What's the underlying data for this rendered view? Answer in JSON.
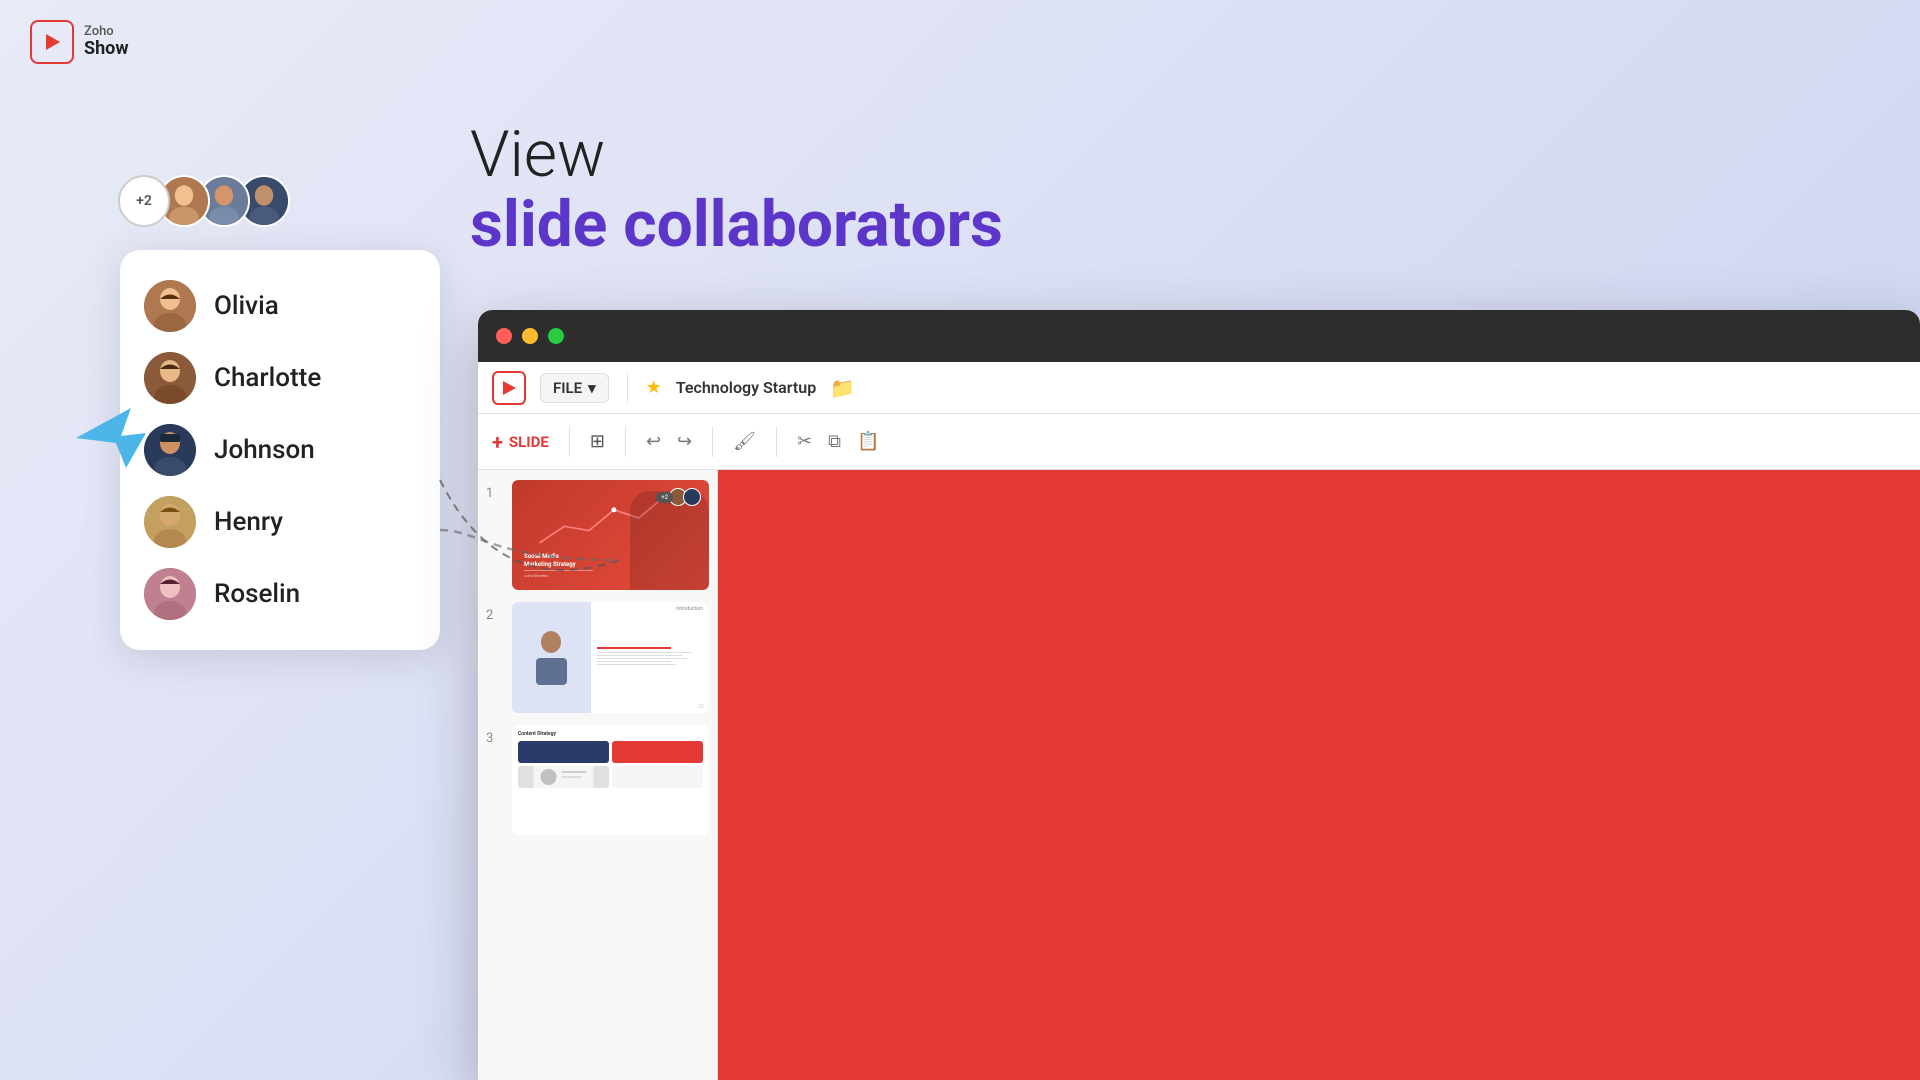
{
  "app": {
    "name": "Zoho Show",
    "logo_text_top": "Zoho",
    "logo_text_bottom": "Show"
  },
  "heading": {
    "line1": "View",
    "line2": "slide collaborators"
  },
  "floating_avatars": {
    "plus_count": "+2"
  },
  "collaborators": [
    {
      "name": "Olivia",
      "color": "#b07850"
    },
    {
      "name": "Charlotte",
      "color": "#8a5a3a"
    },
    {
      "name": "Johnson",
      "color": "#2a3a5a"
    },
    {
      "name": "Henry",
      "color": "#c4a060"
    },
    {
      "name": "Roselin",
      "color": "#b06080"
    }
  ],
  "browser": {
    "toolbar": {
      "file_label": "FILE",
      "file_dropdown_arrow": "▾",
      "star": "★",
      "title": "Technology Startup",
      "folder_icon": "📁"
    },
    "slidebar": {
      "slide_label": "SLIDE",
      "plus": "+"
    },
    "slides": [
      {
        "number": "1",
        "type": "social-media"
      },
      {
        "number": "2",
        "type": "intro"
      },
      {
        "number": "3",
        "type": "content"
      }
    ],
    "collab_badge": "+2"
  },
  "slide1": {
    "title": "Social Media",
    "subtitle": "Marketing Strategy",
    "name": "John Simeths"
  },
  "slide2": {
    "label": "Introduction"
  },
  "slide3": {
    "label": "Content Strategy"
  }
}
